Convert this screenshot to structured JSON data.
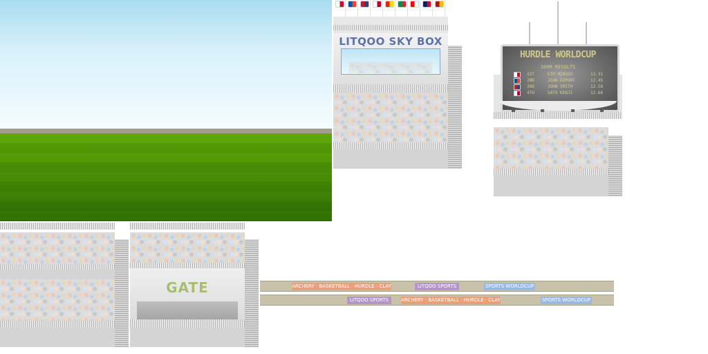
{
  "skybox": {
    "title": "LITQOO SKY BOX",
    "flags": [
      {
        "name": "korea-flag",
        "color": "#ffffff",
        "accent": "#c8102e"
      },
      {
        "name": "france-flag",
        "color": "#0055a4",
        "accent": "#ef4135"
      },
      {
        "name": "usa-flag",
        "color": "#b22234",
        "accent": "#3c3b6e"
      },
      {
        "name": "japan-flag",
        "color": "#ffffff",
        "accent": "#bc002d"
      },
      {
        "name": "china-flag",
        "color": "#de2910",
        "accent": "#ffde00"
      },
      {
        "name": "italy-flag",
        "color": "#009246",
        "accent": "#ce2b37"
      },
      {
        "name": "canada-flag",
        "color": "#ff0000",
        "accent": "#ffffff"
      },
      {
        "name": "uk-flag",
        "color": "#012169",
        "accent": "#c8102e"
      },
      {
        "name": "spain-flag",
        "color": "#aa151b",
        "accent": "#f1bf00"
      }
    ]
  },
  "scoreboard": {
    "title": "HURDLE WORLDCUP",
    "subtitle": "100M RESULTS",
    "rows": [
      {
        "flag": "korea-flag",
        "flag_color": "#ffffff",
        "rank": "1ST",
        "name": "KIM MINSOO",
        "time": "12.31"
      },
      {
        "flag": "france-flag",
        "flag_color": "#0055a4",
        "rank": "2ND",
        "name": "JEAN DUPONT",
        "time": "12.45"
      },
      {
        "flag": "usa-flag",
        "flag_color": "#b22234",
        "rank": "3RD",
        "name": "JOHN SMITH",
        "time": "12.58"
      },
      {
        "flag": "japan-flag",
        "flag_color": "#ffffff",
        "rank": "4TH",
        "name": "SATO KENJI",
        "time": "12.66"
      }
    ]
  },
  "gate": {
    "label": "GATE"
  },
  "ads": {
    "row1": [
      {
        "text": "ARCHERY · BASKETBALL · HURDLE · CLAY",
        "color": "#e8a07c"
      },
      {
        "text": "LITQOO SPORTS",
        "color": "#b495c9"
      },
      {
        "text": "SPORTS WORLDCUP",
        "color": "#9ab9e2"
      }
    ],
    "row2": [
      {
        "text": "LITQOO SPORTS",
        "color": "#b495c9"
      },
      {
        "text": "ARCHERY · BASKETBALL · HURDLE · CLAY",
        "color": "#e8a07c"
      },
      {
        "text": "SPORTS WORLDCUP",
        "color": "#9ab9e2"
      }
    ]
  }
}
